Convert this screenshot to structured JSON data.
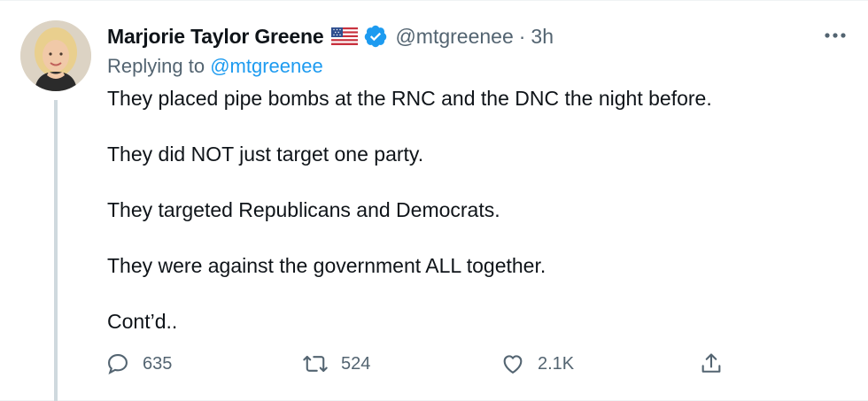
{
  "tweet": {
    "author_name": "Marjorie Taylor Greene",
    "author_handle": "@mtgreenee",
    "separator": "·",
    "timestamp": "3h",
    "flag_icon": "us-flag-icon",
    "verified_icon": "verified-badge-icon",
    "reply_prefix": "Replying to",
    "reply_to": "@mtgreenee",
    "paragraphs": [
      "They placed pipe bombs at the RNC and the DNC the night before.",
      "They did NOT just target one party.",
      "They targeted Republicans and Democrats.",
      "They were against the government ALL together.",
      "Cont’d.."
    ]
  },
  "actions": {
    "reply_count": "635",
    "retweet_count": "524",
    "like_count": "2.1K",
    "reply_icon": "reply-icon",
    "retweet_icon": "retweet-icon",
    "like_icon": "heart-icon",
    "share_icon": "share-icon",
    "more_icon": "more-options-icon"
  },
  "colors": {
    "text": "#0f1419",
    "secondary": "#536471",
    "link": "#1d9bf0",
    "thread_line": "#cfd9de"
  }
}
